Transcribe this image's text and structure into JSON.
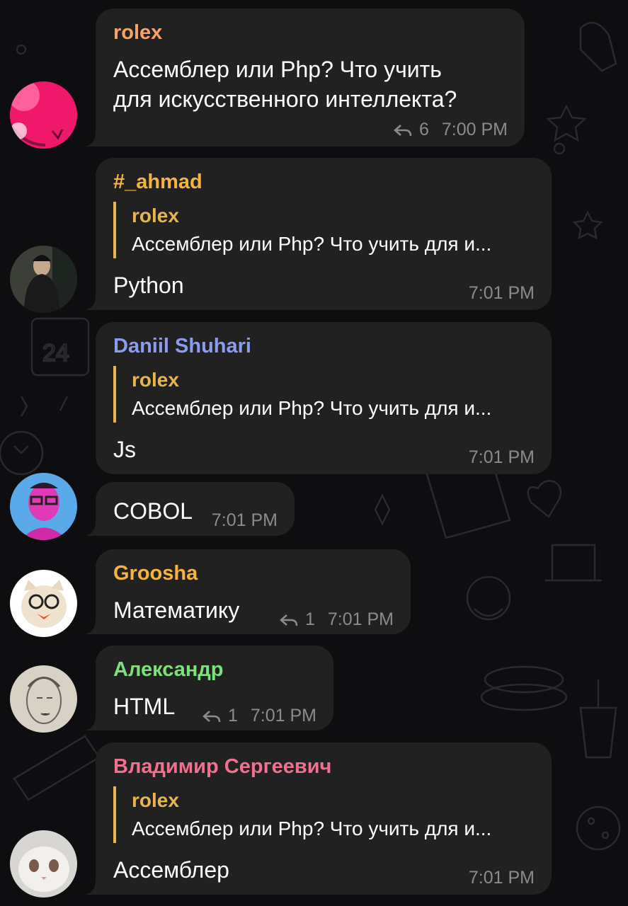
{
  "colors": {
    "background": "#0e0e10",
    "bubble": "#212121",
    "meta_text": "#8b8b8e",
    "quote_bar": "#e8b54d"
  },
  "messages": [
    {
      "author": "rolex",
      "author_color": "#f7a26b",
      "text_line1": "Ассемблер или Php? Что учить",
      "text_line2": "для искусственного интеллекта?",
      "reply_count": "6",
      "time": "7:00 PM",
      "avatar": "pink-avatar"
    },
    {
      "author": "#_ahmad",
      "author_color": "#f5b442",
      "quote_author": "rolex",
      "quote_text": "Ассемблер или Php? Что учить для и...",
      "text": "Python",
      "time": "7:01 PM",
      "avatar": "hooded-person-avatar"
    },
    {
      "author": "Daniil Shuhari",
      "author_color": "#8b9cf0",
      "quote_author": "rolex",
      "quote_text": "Ассемблер или Php? Что учить для и...",
      "text": "Js",
      "time": "7:01 PM"
    },
    {
      "text": "COBOL",
      "time": "7:01 PM",
      "avatar": "blue-selfie-avatar"
    },
    {
      "author": "Groosha",
      "author_color": "#f5b442",
      "text": "Математику",
      "reply_count": "1",
      "time": "7:01 PM",
      "avatar": "cat-with-glasses-avatar"
    },
    {
      "author": "Александр",
      "author_color": "#7ee07a",
      "text": "HTML",
      "reply_count": "1",
      "time": "7:01 PM",
      "avatar": "pencil-sketch-avatar"
    },
    {
      "author": "Владимир Сергеевич",
      "author_color": "#f07090",
      "quote_author": "rolex",
      "quote_text": "Ассемблер или Php? Что учить для и...",
      "text": "Ассемблер",
      "time": "7:01 PM",
      "avatar": "white-cat-avatar"
    }
  ]
}
